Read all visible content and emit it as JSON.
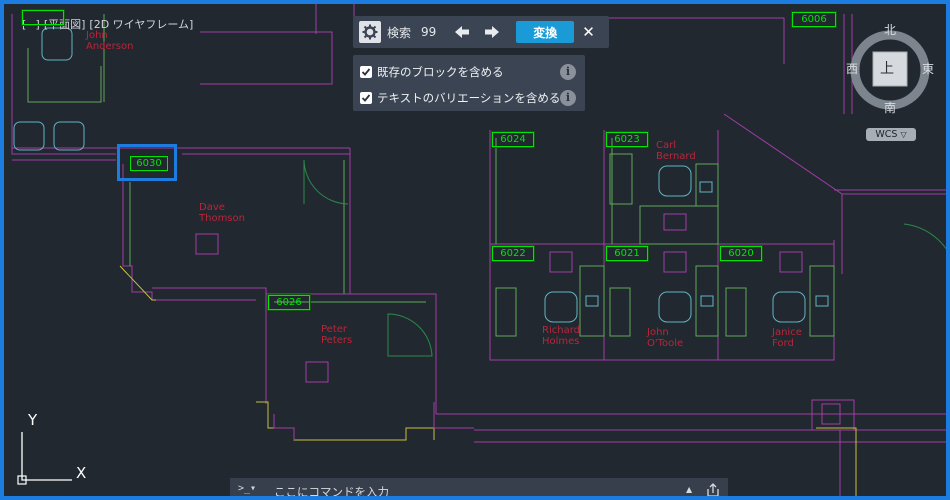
{
  "viewport": {
    "label_minus": "[−]",
    "view_name": "[平面図]",
    "visual_style": "[2D ワイヤフレーム]"
  },
  "find_toolbar": {
    "search_label": "検索",
    "search_count": "99",
    "replace_label": "変換",
    "close_label": "✕",
    "prev_icon": "arrow-left-icon",
    "next_icon": "arrow-right-icon"
  },
  "find_options": [
    {
      "label": "既存のブロックを含める",
      "checked": true
    },
    {
      "label": "テキストのバリエーションを含める",
      "checked": true
    }
  ],
  "viewcube": {
    "north": "北",
    "south": "南",
    "east": "東",
    "west": "西",
    "face": "上",
    "coordinate_system": "WCS"
  },
  "room_tags": [
    "6006",
    "6024",
    "6023",
    "6022",
    "6021",
    "6020",
    "6030",
    "6026"
  ],
  "occupants": {
    "top_left": "John\nAnderson",
    "dave": "Dave\nThomson",
    "peter": "Peter\nPeters",
    "carl": "Carl\nBernard",
    "richard": "Richard\nHolmes",
    "john_o": "John\nO'Toole",
    "janice": "Janice\nFord"
  },
  "command_line": {
    "prompt": ">_▾",
    "placeholder": "ここにコマンドを入力",
    "history_icon": "command-history-icon"
  },
  "ucs": {
    "x_label": "X",
    "y_label": "Y"
  },
  "colors": {
    "accent": "#1d7ce0",
    "replace_button": "#1a9ad6",
    "tag_green": "#00e600",
    "wall_magenta": "#a23ca6",
    "furniture_cyan": "#5fb6c4",
    "occupant_red": "#b8263a"
  }
}
